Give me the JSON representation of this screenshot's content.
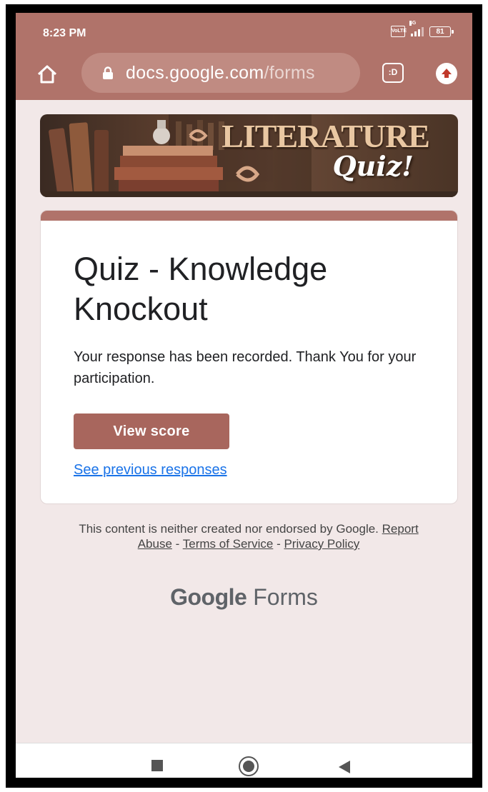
{
  "status_bar": {
    "time": "8:23 PM",
    "volte": "VoLTE",
    "network": "4G",
    "battery": "81"
  },
  "browser": {
    "url_host": "docs.google.com",
    "url_path": "/forms",
    "tabs_label": ":D",
    "icons": [
      "home-icon",
      "lock-icon",
      "tabs-icon",
      "upload-icon"
    ]
  },
  "banner": {
    "title": "LITERATURE",
    "subtitle": "Quiz!"
  },
  "card": {
    "title": "Quiz - Knowledge Knockout",
    "message": "Your response has been recorded. Thank You for your participation.",
    "view_score": "View score",
    "previous_link": "See previous responses"
  },
  "footer": {
    "disclaimer_prefix": "This content is neither created nor endorsed by Google.",
    "report_abuse": "Report Abuse",
    "sep1": "-",
    "terms": "Terms of Service",
    "sep2": "-",
    "privacy": "Privacy Policy",
    "brand_google": "Google",
    "brand_forms": "Forms"
  },
  "colors": {
    "accent": "#b0736a",
    "button": "#a8665d",
    "page_bg": "#f2e8e8",
    "link": "#1a73e8"
  }
}
